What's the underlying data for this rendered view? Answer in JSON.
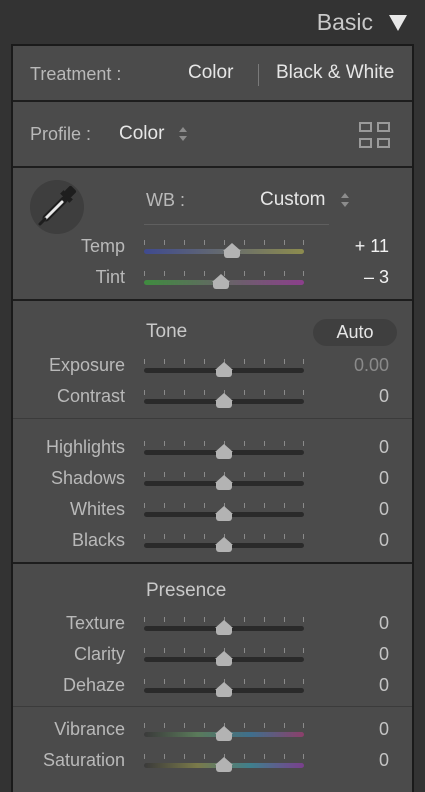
{
  "header": {
    "title": "Basic"
  },
  "treatment": {
    "label": "Treatment :",
    "option_color": "Color",
    "option_bw": "Black & White"
  },
  "profile": {
    "label": "Profile :",
    "value": "Color"
  },
  "wb": {
    "label": "WB :",
    "value": "Custom"
  },
  "sliders": {
    "temp": {
      "label": "Temp",
      "value": "+ 11",
      "position": 0.55
    },
    "tint": {
      "label": "Tint",
      "value": "– 3",
      "position": 0.48
    },
    "exposure": {
      "label": "Exposure",
      "value": "0.00",
      "position": 0.5
    },
    "contrast": {
      "label": "Contrast",
      "value": "0",
      "position": 0.5
    },
    "highlights": {
      "label": "Highlights",
      "value": "0",
      "position": 0.5
    },
    "shadows": {
      "label": "Shadows",
      "value": "0",
      "position": 0.5
    },
    "whites": {
      "label": "Whites",
      "value": "0",
      "position": 0.5
    },
    "blacks": {
      "label": "Blacks",
      "value": "0",
      "position": 0.5
    },
    "texture": {
      "label": "Texture",
      "value": "0",
      "position": 0.5
    },
    "clarity": {
      "label": "Clarity",
      "value": "0",
      "position": 0.5
    },
    "dehaze": {
      "label": "Dehaze",
      "value": "0",
      "position": 0.5
    },
    "vibrance": {
      "label": "Vibrance",
      "value": "0",
      "position": 0.5
    },
    "saturation": {
      "label": "Saturation",
      "value": "0",
      "position": 0.5
    }
  },
  "tone": {
    "title": "Tone",
    "auto_label": "Auto"
  },
  "presence": {
    "title": "Presence"
  },
  "colors": {
    "temp_gradient": [
      "#3f4a8f",
      "#8d8c4e"
    ],
    "tint_gradient": [
      "#3f8c3f",
      "#8c3f8c"
    ],
    "vibrance_gradient": [
      "#3a3a3a",
      "#5a7a5a",
      "#3f6f8c",
      "#8c3f6a"
    ],
    "saturation_gradient": [
      "#3a3a3a",
      "#7a7a4a",
      "#3f7f8c",
      "#7a3f8c"
    ]
  },
  "icons": {
    "collapse": "triangle-down-icon",
    "profile_browser": "grid-icon",
    "wb_picker": "eyedropper-icon"
  }
}
